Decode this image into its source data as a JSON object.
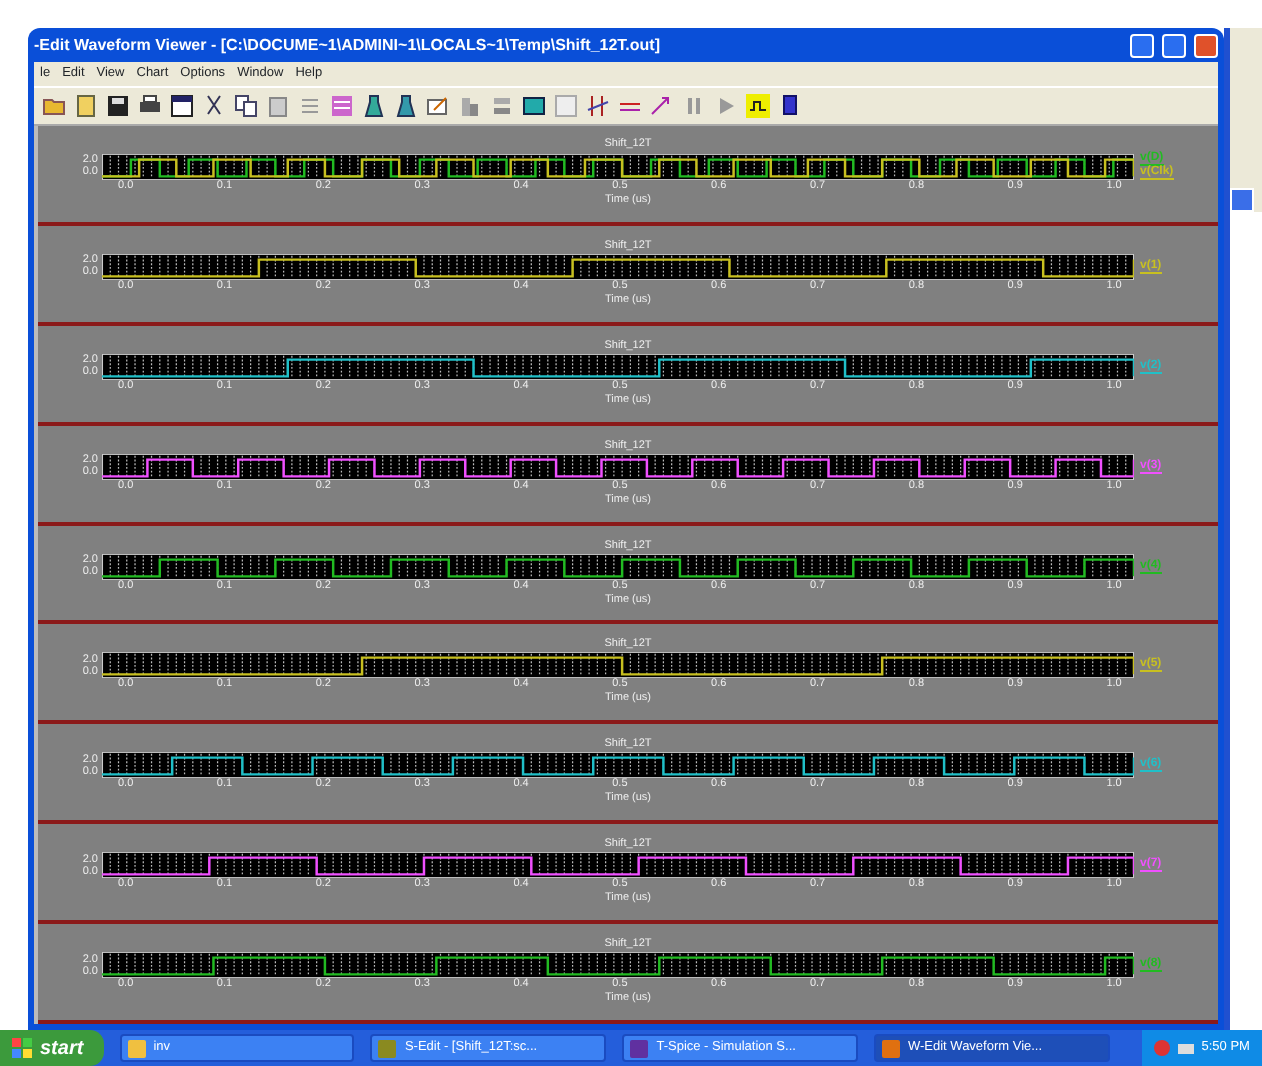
{
  "window": {
    "title": "-Edit Waveform Viewer - [C:\\DOCUME~1\\ADMINI~1\\LOCALS~1\\Temp\\Shift_12T.out]"
  },
  "menu": [
    "le",
    "Edit",
    "View",
    "Chart",
    "Options",
    "Window",
    "Help"
  ],
  "panels": [
    {
      "title": "Shift_12T",
      "yticks": [
        "2.0",
        "0.0"
      ],
      "xticks": [
        "0.0",
        "0.1",
        "0.2",
        "0.3",
        "0.4",
        "0.5",
        "0.6",
        "0.7",
        "0.8",
        "0.9",
        "1.0"
      ],
      "xlabel": "Time (us)",
      "traces": [
        {
          "label": "v(D)",
          "color": "#22bb22"
        },
        {
          "label": "v(Clk)",
          "color": "#c8c020"
        }
      ]
    },
    {
      "title": "Shift_12T",
      "yticks": [
        "2.0",
        "0.0"
      ],
      "xticks": [
        "0.0",
        "0.1",
        "0.2",
        "0.3",
        "0.4",
        "0.5",
        "0.6",
        "0.7",
        "0.8",
        "0.9",
        "1.0"
      ],
      "xlabel": "Time (us)",
      "traces": [
        {
          "label": "v(1)",
          "color": "#c8c020"
        }
      ]
    },
    {
      "title": "Shift_12T",
      "yticks": [
        "2.0",
        "0.0"
      ],
      "xticks": [
        "0.0",
        "0.1",
        "0.2",
        "0.3",
        "0.4",
        "0.5",
        "0.6",
        "0.7",
        "0.8",
        "0.9",
        "1.0"
      ],
      "xlabel": "Time (us)",
      "traces": [
        {
          "label": "v(2)",
          "color": "#20c0c8"
        }
      ]
    },
    {
      "title": "Shift_12T",
      "yticks": [
        "2.0",
        "0.0"
      ],
      "xticks": [
        "0.0",
        "0.1",
        "0.2",
        "0.3",
        "0.4",
        "0.5",
        "0.6",
        "0.7",
        "0.8",
        "0.9",
        "1.0"
      ],
      "xlabel": "Time (us)",
      "traces": [
        {
          "label": "v(3)",
          "color": "#f050ff"
        }
      ]
    },
    {
      "title": "Shift_12T",
      "yticks": [
        "2.0",
        "0.0"
      ],
      "xticks": [
        "0.0",
        "0.1",
        "0.2",
        "0.3",
        "0.4",
        "0.5",
        "0.6",
        "0.7",
        "0.8",
        "0.9",
        "1.0"
      ],
      "xlabel": "Time (us)",
      "traces": [
        {
          "label": "v(4)",
          "color": "#22bb22"
        }
      ]
    },
    {
      "title": "Shift_12T",
      "yticks": [
        "2.0",
        "0.0"
      ],
      "xticks": [
        "0.0",
        "0.1",
        "0.2",
        "0.3",
        "0.4",
        "0.5",
        "0.6",
        "0.7",
        "0.8",
        "0.9",
        "1.0"
      ],
      "xlabel": "Time (us)",
      "traces": [
        {
          "label": "v(5)",
          "color": "#c8c020"
        }
      ]
    },
    {
      "title": "Shift_12T",
      "yticks": [
        "2.0",
        "0.0"
      ],
      "xticks": [
        "0.0",
        "0.1",
        "0.2",
        "0.3",
        "0.4",
        "0.5",
        "0.6",
        "0.7",
        "0.8",
        "0.9",
        "1.0"
      ],
      "xlabel": "Time (us)",
      "traces": [
        {
          "label": "v(6)",
          "color": "#20c0c8"
        }
      ]
    },
    {
      "title": "Shift_12T",
      "yticks": [
        "2.0",
        "0.0"
      ],
      "xticks": [
        "0.0",
        "0.1",
        "0.2",
        "0.3",
        "0.4",
        "0.5",
        "0.6",
        "0.7",
        "0.8",
        "0.9",
        "1.0"
      ],
      "xlabel": "Time (us)",
      "traces": [
        {
          "label": "v(7)",
          "color": "#f050ff"
        }
      ]
    },
    {
      "title": "Shift_12T",
      "yticks": [
        "2.0",
        "0.0"
      ],
      "xticks": [
        "0.0",
        "0.1",
        "0.2",
        "0.3",
        "0.4",
        "0.5",
        "0.6",
        "0.7",
        "0.8",
        "0.9",
        "1.0"
      ],
      "xlabel": "Time (us)",
      "traces": [
        {
          "label": "v(8)",
          "color": "#22bb22"
        }
      ]
    }
  ],
  "taskbar": {
    "start": "start",
    "tasks": [
      {
        "label": "inv",
        "kind": "folder",
        "selected": false
      },
      {
        "label": "S-Edit - [Shift_12T:sc...",
        "kind": "s",
        "selected": false
      },
      {
        "label": "T-Spice - Simulation S...",
        "kind": "t",
        "selected": false
      },
      {
        "label": "W-Edit Waveform Vie...",
        "kind": "w",
        "selected": true
      }
    ],
    "clock": "5:50 PM"
  }
}
